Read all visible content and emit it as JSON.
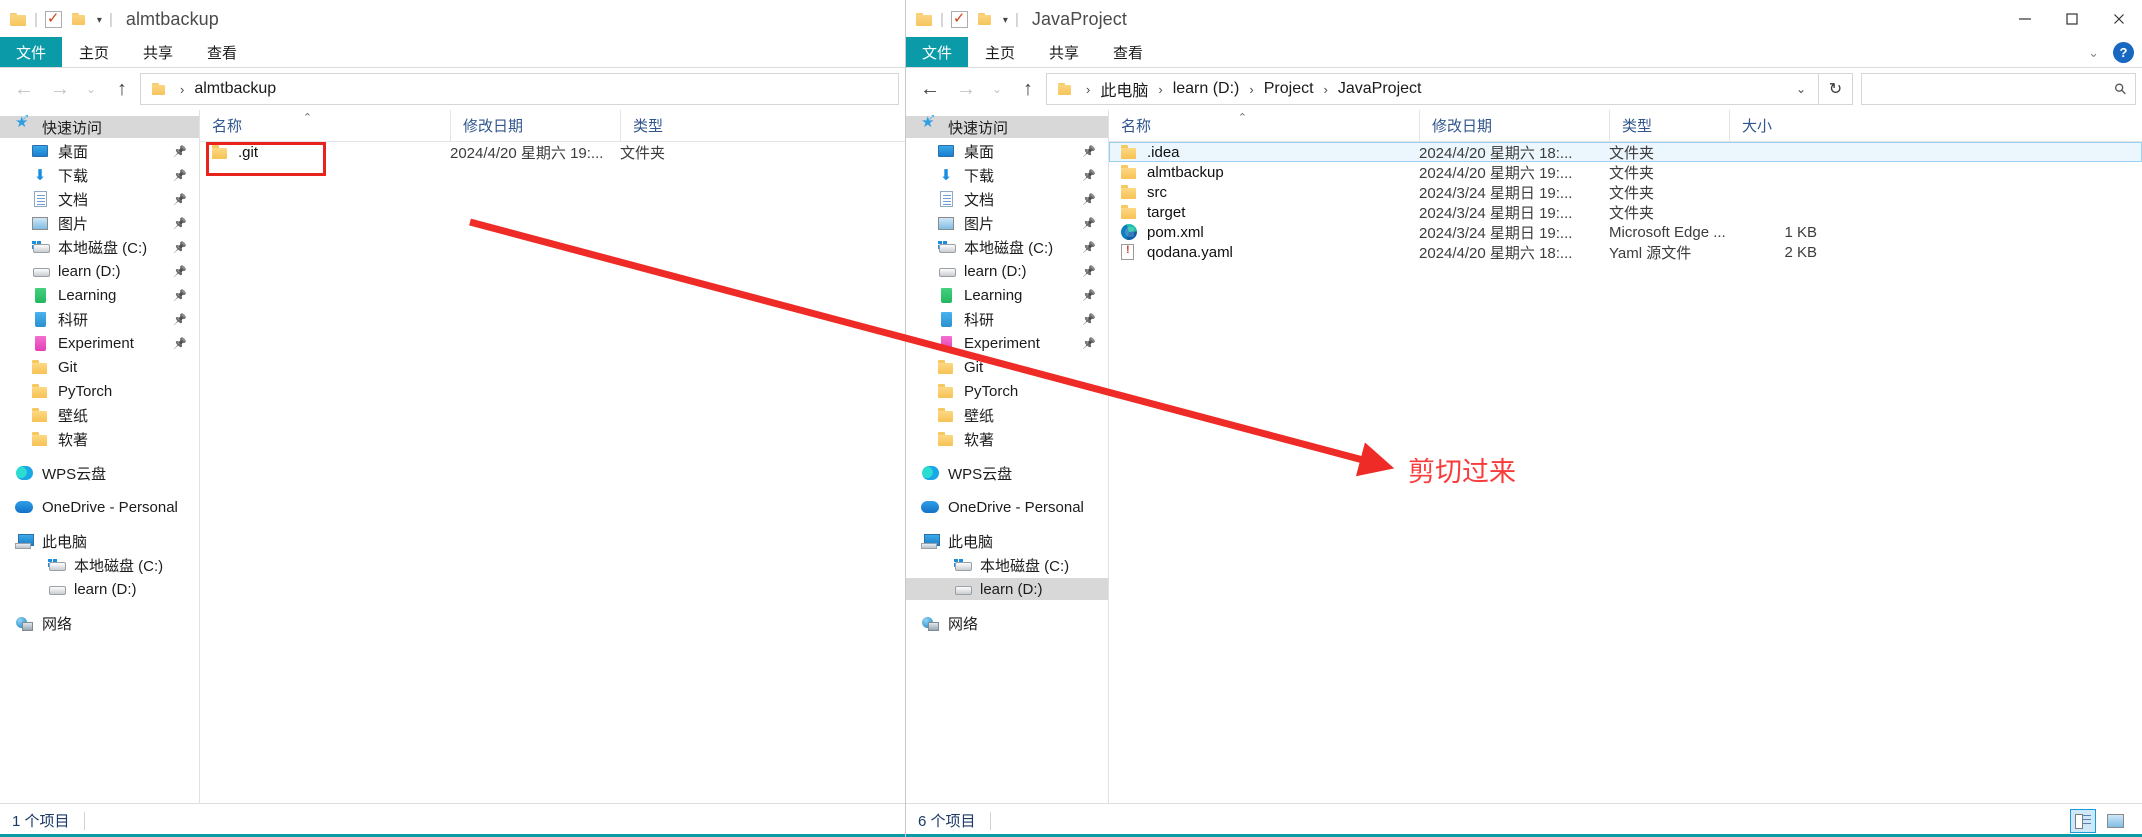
{
  "left_window": {
    "titlebar": {
      "title": "almtbackup",
      "icons": [
        "folder-icon",
        "checkbox-icon",
        "folder-icon",
        "dropdown-caret-icon"
      ]
    },
    "ribbon": {
      "file_tab": "文件",
      "tabs": [
        "主页",
        "共享",
        "查看"
      ]
    },
    "address": {
      "back": "←",
      "forward": "→",
      "recent": "⌄",
      "up": "↑",
      "crumbs": [
        "almtbackup"
      ]
    },
    "nav": {
      "quick_access": "快速访问",
      "quick_items": [
        {
          "label": "桌面",
          "icon": "desktop-icon",
          "pinned": true
        },
        {
          "label": "下载",
          "icon": "downloads-icon",
          "pinned": true
        },
        {
          "label": "文档",
          "icon": "documents-icon",
          "pinned": true
        },
        {
          "label": "图片",
          "icon": "pictures-icon",
          "pinned": true
        },
        {
          "label": "本地磁盘 (C:)",
          "icon": "windows-disk-icon",
          "pinned": true
        },
        {
          "label": "learn (D:)",
          "icon": "disk-icon",
          "pinned": true
        },
        {
          "label": "Learning",
          "icon": "green-book-icon",
          "pinned": true
        },
        {
          "label": "科研",
          "icon": "blue-book-icon",
          "pinned": true
        },
        {
          "label": "Experiment",
          "icon": "pink-book-icon",
          "pinned": true
        },
        {
          "label": "Git",
          "icon": "folder-icon",
          "pinned": false
        },
        {
          "label": "PyTorch",
          "icon": "folder-icon",
          "pinned": false
        },
        {
          "label": "壁纸",
          "icon": "folder-icon",
          "pinned": false
        },
        {
          "label": "软著",
          "icon": "folder-icon",
          "pinned": false
        }
      ],
      "wps": "WPS云盘",
      "onedrive": "OneDrive - Personal",
      "this_pc": "此电脑",
      "pc_children": [
        {
          "label": "本地磁盘 (C:)",
          "icon": "windows-disk-icon"
        },
        {
          "label": "learn (D:)",
          "icon": "disk-icon"
        }
      ],
      "network": "网络"
    },
    "columns": [
      "名称",
      "修改日期",
      "类型"
    ],
    "rows": [
      {
        "name": ".git",
        "date": "2024/4/20 星期六 19:...",
        "type": "文件夹",
        "size": "",
        "icon": "folder-icon",
        "highlighted": true
      }
    ],
    "status": {
      "count": "1 个项目"
    }
  },
  "right_window": {
    "titlebar": {
      "title": "JavaProject",
      "icons": [
        "folder-icon",
        "checkbox-icon",
        "folder-icon",
        "dropdown-caret-icon"
      ],
      "minimize": "—",
      "maximize": "□",
      "close": "✕"
    },
    "ribbon": {
      "file_tab": "文件",
      "tabs": [
        "主页",
        "共享",
        "查看"
      ],
      "help": "?"
    },
    "address": {
      "back": "←",
      "forward": "→",
      "recent": "⌄",
      "up": "↑",
      "crumbs": [
        "此电脑",
        "learn (D:)",
        "Project",
        "JavaProject"
      ],
      "dropdown": "⌄",
      "refresh": "↻",
      "search_placeholder": ""
    },
    "nav": {
      "quick_access": "快速访问",
      "quick_items": [
        {
          "label": "桌面",
          "icon": "desktop-icon",
          "pinned": true
        },
        {
          "label": "下载",
          "icon": "downloads-icon",
          "pinned": true
        },
        {
          "label": "文档",
          "icon": "documents-icon",
          "pinned": true
        },
        {
          "label": "图片",
          "icon": "pictures-icon",
          "pinned": true
        },
        {
          "label": "本地磁盘 (C:)",
          "icon": "windows-disk-icon",
          "pinned": true
        },
        {
          "label": "learn (D:)",
          "icon": "disk-icon",
          "pinned": true
        },
        {
          "label": "Learning",
          "icon": "green-book-icon",
          "pinned": true
        },
        {
          "label": "科研",
          "icon": "blue-book-icon",
          "pinned": true
        },
        {
          "label": "Experiment",
          "icon": "pink-book-icon",
          "pinned": true
        },
        {
          "label": "Git",
          "icon": "folder-icon",
          "pinned": false
        },
        {
          "label": "PyTorch",
          "icon": "folder-icon",
          "pinned": false
        },
        {
          "label": "壁纸",
          "icon": "folder-icon",
          "pinned": false
        },
        {
          "label": "软著",
          "icon": "folder-icon",
          "pinned": false
        }
      ],
      "wps": "WPS云盘",
      "onedrive": "OneDrive - Personal",
      "this_pc": "此电脑",
      "pc_children": [
        {
          "label": "本地磁盘 (C:)",
          "icon": "windows-disk-icon",
          "selected": false
        },
        {
          "label": "learn (D:)",
          "icon": "disk-icon",
          "selected": true
        }
      ],
      "network": "网络"
    },
    "columns": [
      "名称",
      "修改日期",
      "类型",
      "大小"
    ],
    "rows": [
      {
        "name": ".idea",
        "date": "2024/4/20 星期六 18:...",
        "type": "文件夹",
        "size": "",
        "icon": "folder-icon",
        "selected": true
      },
      {
        "name": "almtbackup",
        "date": "2024/4/20 星期六 19:...",
        "type": "文件夹",
        "size": "",
        "icon": "folder-icon",
        "selected": false
      },
      {
        "name": "src",
        "date": "2024/3/24 星期日 19:...",
        "type": "文件夹",
        "size": "",
        "icon": "folder-icon",
        "selected": false
      },
      {
        "name": "target",
        "date": "2024/3/24 星期日 19:...",
        "type": "文件夹",
        "size": "",
        "icon": "folder-icon",
        "selected": false
      },
      {
        "name": "pom.xml",
        "date": "2024/3/24 星期日 19:...",
        "type": "Microsoft Edge ...",
        "size": "1 KB",
        "icon": "edge-file-icon",
        "selected": false
      },
      {
        "name": "qodana.yaml",
        "date": "2024/4/20 星期六 18:...",
        "type": "Yaml 源文件",
        "size": "2 KB",
        "icon": "yaml-file-icon",
        "selected": false
      }
    ],
    "status": {
      "count": "6 个项目",
      "view_details": "details-view-icon",
      "view_tiles": "tiles-view-icon"
    }
  },
  "annotation": {
    "text": "剪切过来",
    "color": "#fa3b3b",
    "arrow": "red-arrow"
  },
  "colors": {
    "accent": "#0b9aa8",
    "annotation_red": "#fa3b3b",
    "highlight_box": "#e8231b",
    "selection_blue": "#ecf6fd",
    "nav_selection": "#d8d8d8",
    "header_text": "#31568e"
  }
}
